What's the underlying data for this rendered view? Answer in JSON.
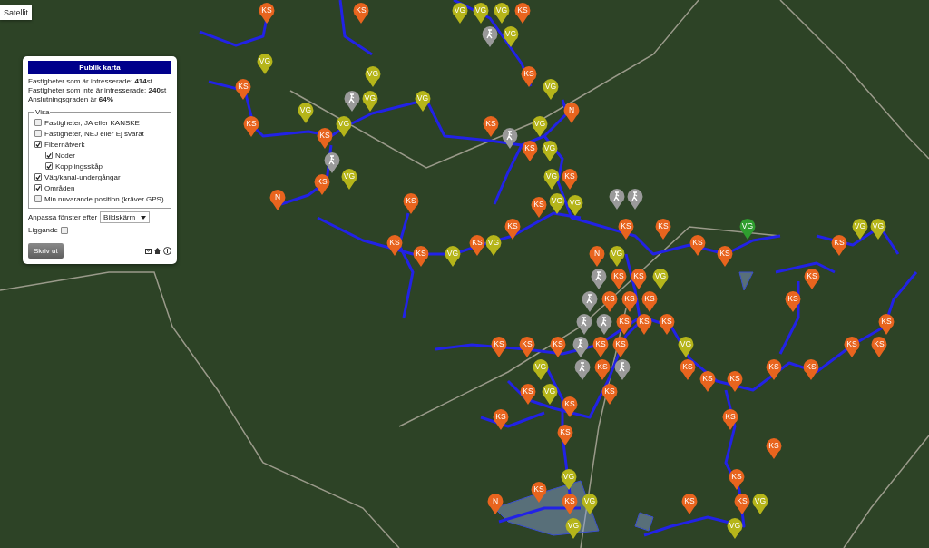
{
  "map_type_button": {
    "label": "Satellit"
  },
  "panel": {
    "title": "Publik karta",
    "stats": [
      "Fastigheter som är intresserade: **414**st",
      "Fastigheter som inte är intresserade: **240**st",
      "Anslutningsgraden är **64%**"
    ],
    "legend": "Visa",
    "options": [
      {
        "label": "Fastigheter, JA eller KANSKE",
        "checked": false
      },
      {
        "label": "Fastigheter, NEJ eller Ej svarat",
        "checked": false
      },
      {
        "label": "Fibernätverk",
        "checked": true,
        "children": [
          {
            "label": "Noder",
            "checked": true
          },
          {
            "label": "Kopplingsskåp",
            "checked": true
          }
        ]
      },
      {
        "label": "Väg/kanal-undergångar",
        "checked": true
      },
      {
        "label": "Områden",
        "checked": true
      },
      {
        "label": "Min nuvarande position (kräver GPS)",
        "checked": false
      }
    ],
    "fit_label": "Anpassa fönster efter",
    "fit_value": "Bildskärm",
    "landscape": {
      "label": "Liggande",
      "checked": false
    },
    "print_button": "Skriv ut"
  },
  "markers": [
    {
      "kind": "text",
      "label": "KS",
      "color": "#e8641e"
    },
    {
      "kind": "text",
      "label": "KS",
      "color": "#e8641e"
    },
    {
      "kind": "text",
      "label": "VG",
      "color": "#b5b51a"
    },
    {
      "kind": "text",
      "label": "VG",
      "color": "#b5b51a"
    },
    {
      "kind": "text",
      "label": "VG",
      "color": "#b5b51a"
    },
    {
      "kind": "text",
      "label": "KS",
      "color": "#e8641e"
    },
    {
      "kind": "icon",
      "color": "#9a9a9a"
    },
    {
      "kind": "text",
      "label": "VG",
      "color": "#b5b51a"
    },
    {
      "kind": "text",
      "label": "VG",
      "color": "#b5b51a"
    },
    {
      "kind": "text",
      "label": "VG",
      "color": "#b5b51a"
    },
    {
      "kind": "text",
      "label": "KS",
      "color": "#e8641e"
    },
    {
      "kind": "text",
      "label": "KS",
      "color": "#e8641e"
    },
    {
      "kind": "text",
      "label": "VG",
      "color": "#b5b51a"
    },
    {
      "kind": "icon",
      "color": "#9a9a9a"
    },
    {
      "kind": "text",
      "label": "VG",
      "color": "#b5b51a"
    },
    {
      "kind": "text",
      "label": "VG",
      "color": "#b5b51a"
    },
    {
      "kind": "text",
      "label": "VG",
      "color": "#b5b51a"
    },
    {
      "kind": "text",
      "label": "N",
      "color": "#e8641e"
    },
    {
      "kind": "text",
      "label": "KS",
      "color": "#e8641e"
    },
    {
      "kind": "text",
      "label": "VG",
      "color": "#b5b51a"
    },
    {
      "kind": "text",
      "label": "KS",
      "color": "#e8641e"
    },
    {
      "kind": "text",
      "label": "VG",
      "color": "#b5b51a"
    },
    {
      "kind": "text",
      "label": "KS",
      "color": "#e8641e"
    },
    {
      "kind": "icon",
      "color": "#9a9a9a"
    },
    {
      "kind": "text",
      "label": "KS",
      "color": "#e8641e"
    },
    {
      "kind": "text",
      "label": "VG",
      "color": "#b5b51a"
    },
    {
      "kind": "icon",
      "color": "#9a9a9a"
    },
    {
      "kind": "text",
      "label": "KS",
      "color": "#e8641e"
    },
    {
      "kind": "text",
      "label": "VG",
      "color": "#b5b51a"
    },
    {
      "kind": "text",
      "label": "VG",
      "color": "#b5b51a"
    },
    {
      "kind": "text",
      "label": "KS",
      "color": "#e8641e"
    },
    {
      "kind": "text",
      "label": "N",
      "color": "#e8641e"
    },
    {
      "kind": "text",
      "label": "KS",
      "color": "#e8641e"
    },
    {
      "kind": "text",
      "label": "KS",
      "color": "#e8641e"
    },
    {
      "kind": "text",
      "label": "VG",
      "color": "#b5b51a"
    },
    {
      "kind": "text",
      "label": "VG",
      "color": "#b5b51a"
    },
    {
      "kind": "icon",
      "color": "#9a9a9a"
    },
    {
      "kind": "icon",
      "color": "#9a9a9a"
    },
    {
      "kind": "text",
      "label": "KS",
      "color": "#e8641e"
    },
    {
      "kind": "text",
      "label": "KS",
      "color": "#e8641e"
    },
    {
      "kind": "text",
      "label": "KS",
      "color": "#e8641e"
    },
    {
      "kind": "text",
      "label": "VG",
      "color": "#2f9e2f"
    },
    {
      "kind": "text",
      "label": "VG",
      "color": "#b5b51a"
    },
    {
      "kind": "text",
      "label": "VG",
      "color": "#b5b51a"
    },
    {
      "kind": "text",
      "label": "KS",
      "color": "#e8641e"
    },
    {
      "kind": "text",
      "label": "KS",
      "color": "#e8641e"
    },
    {
      "kind": "text",
      "label": "VG",
      "color": "#b5b51a"
    },
    {
      "kind": "text",
      "label": "KS",
      "color": "#e8641e"
    },
    {
      "kind": "text",
      "label": "KS",
      "color": "#e8641e"
    },
    {
      "kind": "text",
      "label": "KS",
      "color": "#e8641e"
    },
    {
      "kind": "text",
      "label": "VG",
      "color": "#b5b51a"
    },
    {
      "kind": "text",
      "label": "N",
      "color": "#e8641e"
    },
    {
      "kind": "text",
      "label": "VG",
      "color": "#b5b51a"
    },
    {
      "kind": "text",
      "label": "KS",
      "color": "#e8641e"
    },
    {
      "kind": "icon",
      "color": "#9a9a9a"
    },
    {
      "kind": "text",
      "label": "KS",
      "color": "#e8641e"
    },
    {
      "kind": "text",
      "label": "KS",
      "color": "#e8641e"
    },
    {
      "kind": "text",
      "label": "VG",
      "color": "#b5b51a"
    },
    {
      "kind": "text",
      "label": "KS",
      "color": "#e8641e"
    },
    {
      "kind": "icon",
      "color": "#9a9a9a"
    },
    {
      "kind": "text",
      "label": "KS",
      "color": "#e8641e"
    },
    {
      "kind": "text",
      "label": "KS",
      "color": "#e8641e"
    },
    {
      "kind": "text",
      "label": "KS",
      "color": "#e8641e"
    },
    {
      "kind": "text",
      "label": "KS",
      "color": "#e8641e"
    },
    {
      "kind": "icon",
      "color": "#9a9a9a"
    },
    {
      "kind": "icon",
      "color": "#9a9a9a"
    },
    {
      "kind": "text",
      "label": "KS",
      "color": "#e8641e"
    },
    {
      "kind": "text",
      "label": "KS",
      "color": "#e8641e"
    },
    {
      "kind": "text",
      "label": "KS",
      "color": "#e8641e"
    },
    {
      "kind": "text",
      "label": "KS",
      "color": "#e8641e"
    },
    {
      "kind": "text",
      "label": "KS",
      "color": "#e8641e"
    },
    {
      "kind": "text",
      "label": "KS",
      "color": "#e8641e"
    },
    {
      "kind": "text",
      "label": "KS",
      "color": "#e8641e"
    },
    {
      "kind": "icon",
      "color": "#9a9a9a"
    },
    {
      "kind": "text",
      "label": "KS",
      "color": "#e8641e"
    },
    {
      "kind": "text",
      "label": "KS",
      "color": "#e8641e"
    },
    {
      "kind": "text",
      "label": "VG",
      "color": "#b5b51a"
    },
    {
      "kind": "text",
      "label": "KS",
      "color": "#e8641e"
    },
    {
      "kind": "text",
      "label": "KS",
      "color": "#e8641e"
    },
    {
      "kind": "text",
      "label": "VG",
      "color": "#b5b51a"
    },
    {
      "kind": "icon",
      "color": "#9a9a9a"
    },
    {
      "kind": "text",
      "label": "KS",
      "color": "#e8641e"
    },
    {
      "kind": "icon",
      "color": "#9a9a9a"
    },
    {
      "kind": "text",
      "label": "KS",
      "color": "#e8641e"
    },
    {
      "kind": "text",
      "label": "KS",
      "color": "#e8641e"
    },
    {
      "kind": "text",
      "label": "KS",
      "color": "#e8641e"
    },
    {
      "kind": "text",
      "label": "KS",
      "color": "#e8641e"
    },
    {
      "kind": "text",
      "label": "KS",
      "color": "#e8641e"
    },
    {
      "kind": "text",
      "label": "KS",
      "color": "#e8641e"
    },
    {
      "kind": "text",
      "label": "VG",
      "color": "#b5b51a"
    },
    {
      "kind": "text",
      "label": "KS",
      "color": "#e8641e"
    },
    {
      "kind": "text",
      "label": "KS",
      "color": "#e8641e"
    },
    {
      "kind": "text",
      "label": "KS",
      "color": "#e8641e"
    },
    {
      "kind": "text",
      "label": "KS",
      "color": "#e8641e"
    },
    {
      "kind": "text",
      "label": "KS",
      "color": "#e8641e"
    },
    {
      "kind": "text",
      "label": "KS",
      "color": "#e8641e"
    },
    {
      "kind": "text",
      "label": "VG",
      "color": "#b5b51a"
    },
    {
      "kind": "text",
      "label": "KS",
      "color": "#e8641e"
    },
    {
      "kind": "text",
      "label": "KS",
      "color": "#e8641e"
    },
    {
      "kind": "text",
      "label": "N",
      "color": "#e8641e"
    },
    {
      "kind": "text",
      "label": "KS",
      "color": "#e8641e"
    },
    {
      "kind": "text",
      "label": "VG",
      "color": "#b5b51a"
    },
    {
      "kind": "text",
      "label": "KS",
      "color": "#e8641e"
    },
    {
      "kind": "text",
      "label": "KS",
      "color": "#e8641e"
    },
    {
      "kind": "text",
      "label": "VG",
      "color": "#b5b51a"
    },
    {
      "kind": "text",
      "label": "VG",
      "color": "#b5b51a"
    },
    {
      "kind": "text",
      "label": "VG",
      "color": "#b5b51a"
    }
  ]
}
